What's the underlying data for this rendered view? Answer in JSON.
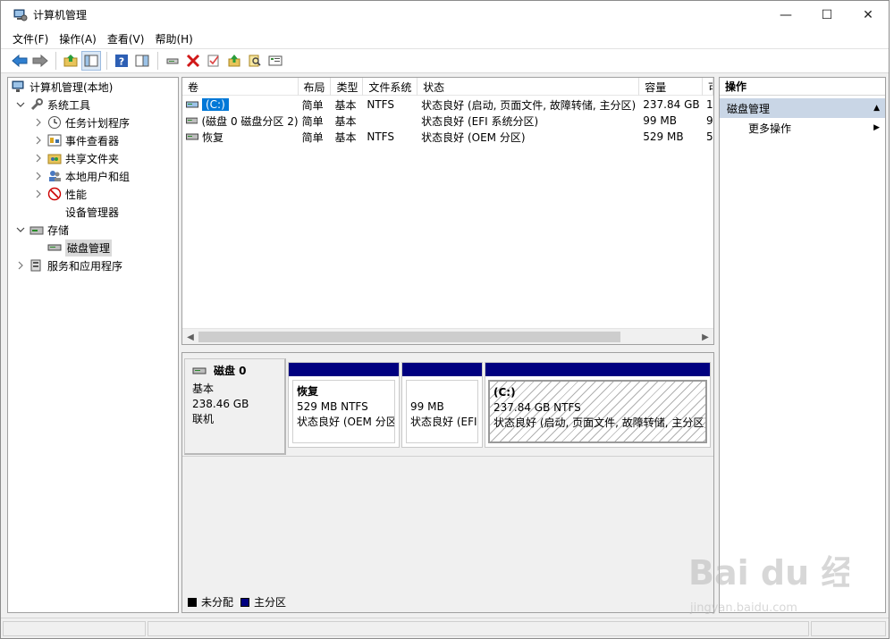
{
  "window": {
    "title": "计算机管理",
    "buttons": {
      "minimize": "—",
      "maximize": "☐",
      "close": "✕"
    }
  },
  "menu": [
    "文件(F)",
    "操作(A)",
    "查看(V)",
    "帮助(H)"
  ],
  "toolbar": [
    "back-arrow-icon",
    "forward-arrow-icon",
    "up-folder-icon",
    "show-tree-icon",
    "help-icon",
    "properties-icon",
    "connect-icon",
    "delete-icon",
    "check-icon",
    "import-icon",
    "search-icon",
    "list-icon"
  ],
  "tree": {
    "items": [
      {
        "label": "计算机管理(本地)",
        "icon": "computer-icon",
        "level": 0,
        "expander": "",
        "selected": false
      },
      {
        "label": "系统工具",
        "icon": "tools-icon",
        "level": 1,
        "expander": "v",
        "selected": false
      },
      {
        "label": "任务计划程序",
        "icon": "clock-icon",
        "level": 2,
        "expander": ">",
        "selected": false
      },
      {
        "label": "事件查看器",
        "icon": "event-icon",
        "level": 2,
        "expander": ">",
        "selected": false
      },
      {
        "label": "共享文件夹",
        "icon": "shared-folder-icon",
        "level": 2,
        "expander": ">",
        "selected": false
      },
      {
        "label": "本地用户和组",
        "icon": "users-icon",
        "level": 2,
        "expander": ">",
        "selected": false
      },
      {
        "label": "性能",
        "icon": "performance-icon",
        "level": 2,
        "expander": ">",
        "selected": false
      },
      {
        "label": "设备管理器",
        "icon": "device-icon",
        "level": 2,
        "expander": "",
        "selected": false
      },
      {
        "label": "存储",
        "icon": "storage-icon",
        "level": 1,
        "expander": "v",
        "selected": false
      },
      {
        "label": "磁盘管理",
        "icon": "disk-icon",
        "level": 2,
        "expander": "",
        "selected": true
      },
      {
        "label": "服务和应用程序",
        "icon": "services-icon",
        "level": 1,
        "expander": ">",
        "selected": false
      }
    ]
  },
  "volumes": {
    "columns": [
      "卷",
      "布局",
      "类型",
      "文件系统",
      "状态",
      "容量",
      "可"
    ],
    "rows": [
      {
        "volume": "(C:)",
        "layout": "简单",
        "type": "基本",
        "fs": "NTFS",
        "status": "状态良好 (启动, 页面文件, 故障转储, 主分区)",
        "capacity": "237.84 GB",
        "free": "1",
        "selected": true
      },
      {
        "volume": "(磁盘 0 磁盘分区 2)",
        "layout": "简单",
        "type": "基本",
        "fs": "",
        "status": "状态良好 (EFI 系统分区)",
        "capacity": "99 MB",
        "free": "9",
        "selected": false
      },
      {
        "volume": "恢复",
        "layout": "简单",
        "type": "基本",
        "fs": "NTFS",
        "status": "状态良好 (OEM 分区)",
        "capacity": "529 MB",
        "free": "5",
        "selected": false
      }
    ]
  },
  "disk": {
    "name": "磁盘 0",
    "type": "基本",
    "size": "238.46 GB",
    "state": "联机",
    "partitions": [
      {
        "name": "恢复",
        "size": "529 MB NTFS",
        "status": "状态良好 (OEM 分区",
        "hatched": false
      },
      {
        "name": "",
        "size": "99 MB",
        "status": "状态良好 (EFI",
        "hatched": false
      },
      {
        "name": "(C:)",
        "size": "237.84 GB NTFS",
        "status": "状态良好 (启动, 页面文件, 故障转储, 主分区)",
        "hatched": true
      }
    ]
  },
  "legend": [
    {
      "label": "未分配",
      "color": "#000000"
    },
    {
      "label": "主分区",
      "color": "#000080"
    }
  ],
  "actions": {
    "header": "操作",
    "section": "磁盘管理",
    "items": [
      "更多操作"
    ]
  },
  "watermark": {
    "text": "Bai du 经验",
    "url": "jingyan.baidu.com"
  }
}
